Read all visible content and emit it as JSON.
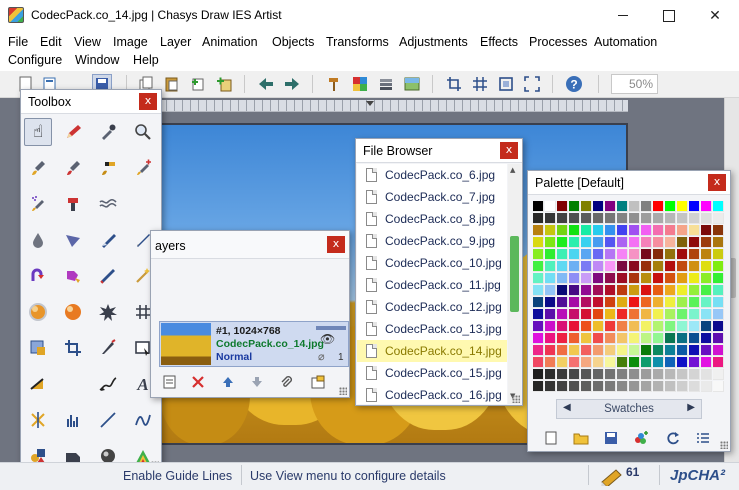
{
  "window": {
    "title": "CodecPack.co_14.jpg | Chasys Draw IES Artist"
  },
  "menu": {
    "row1": [
      "File",
      "Edit",
      "View",
      "Image",
      "Layer",
      "Animation",
      "Objects",
      "Transforms",
      "Adjustments",
      "Effects",
      "Processes",
      "Automation"
    ],
    "row2": [
      "Configure",
      "Window",
      "Help"
    ]
  },
  "toolbar": {
    "zoom_value": "50%"
  },
  "toolbox": {
    "title": "Toolbox",
    "close_label": "x"
  },
  "layers": {
    "title": "ayers",
    "close_label": "x",
    "layer": {
      "info": "#1, 1024×768",
      "name": "CodecPack.co_14.jpg",
      "mode": "Normal",
      "link_count": "1"
    }
  },
  "file_browser": {
    "title": "File Browser",
    "close_label": "x",
    "selected": "CodecPack.co_14.jpg",
    "files": [
      "CodecPack.co_6.jpg",
      "CodecPack.co_7.jpg",
      "CodecPack.co_8.jpg",
      "CodecPack.co_9.jpg",
      "CodecPack.co_10.jpg",
      "CodecPack.co_11.jpg",
      "CodecPack.co_12.jpg",
      "CodecPack.co_13.jpg",
      "CodecPack.co_14.jpg",
      "CodecPack.co_15.jpg",
      "CodecPack.co_16.jpg"
    ]
  },
  "palette": {
    "title": "Palette [Default]",
    "close_label": "x",
    "set_label": "Swatches"
  },
  "status": {
    "hint_label": "Enable Guide Lines",
    "hint_detail": "Use View menu to configure details",
    "count": "61",
    "brand": "JpCHA²"
  },
  "colors": {
    "accent_close": "#c42b1c",
    "selection_yellow": "#fff9b0",
    "layer_name_green": "#0e7a2d",
    "scroll_green": "#5cb85c"
  }
}
